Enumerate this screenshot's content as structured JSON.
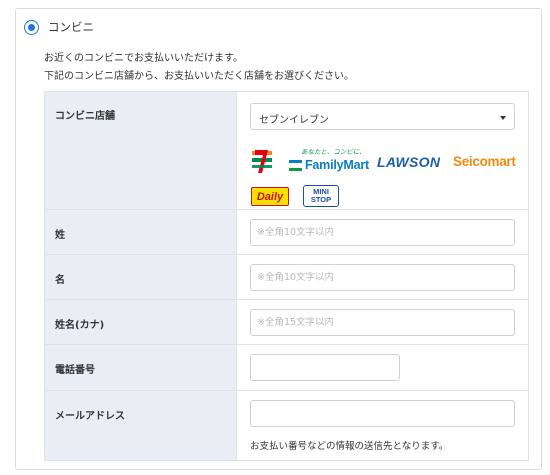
{
  "payment_option": {
    "label": "コンビニ",
    "selected": true,
    "description_line1": "お近くのコンビニでお支払いいただけます。",
    "description_line2": "下記のコンビニ店舗から、お支払いいただく店舗をお選びください。"
  },
  "form": {
    "store": {
      "label": "コンビニ店舗",
      "selected": "セブンイレブン",
      "logos": [
        {
          "name": "seven-eleven",
          "text": "7"
        },
        {
          "name": "familymart",
          "tagline": "あなたと、コンビに、",
          "text": "FamilyMart"
        },
        {
          "name": "lawson",
          "text": "LAWSON"
        },
        {
          "name": "seicomart",
          "text": "Seicomart"
        },
        {
          "name": "daily-yamazaki",
          "text": "Daily"
        },
        {
          "name": "ministop",
          "line1": "MINI",
          "line2": "STOP"
        }
      ]
    },
    "last_name": {
      "label": "姓",
      "value": "",
      "placeholder": "※全角10文字以内"
    },
    "first_name": {
      "label": "名",
      "value": "",
      "placeholder": "※全角10文字以内"
    },
    "kana_name": {
      "label": "姓名(カナ)",
      "value": "",
      "placeholder": "※全角15文字以内"
    },
    "phone": {
      "label": "電話番号",
      "value": "",
      "placeholder": ""
    },
    "email": {
      "label": "メールアドレス",
      "value": "",
      "placeholder": "",
      "note": "お支払い番号などの情報の送信先となります。"
    }
  },
  "colors": {
    "accent": "#1a73e8",
    "label_bg": "#e9eef5",
    "seven_red": "#e60012",
    "seven_green": "#008a4c",
    "seven_orange": "#f58220",
    "familymart_green": "#0a9a44",
    "familymart_blue": "#0a7ec2",
    "lawson_blue": "#1d5fa8",
    "seicomart_orange": "#f08a12"
  }
}
